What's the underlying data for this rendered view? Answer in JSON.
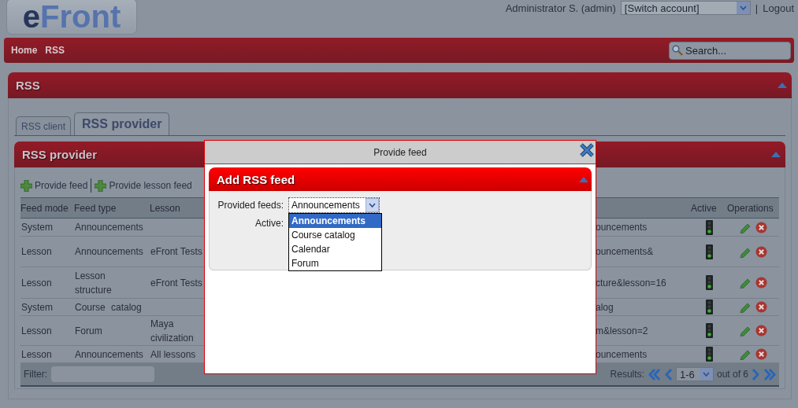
{
  "header": {
    "logo": [
      "e",
      "Front"
    ],
    "user": "Administrator S. (admin)",
    "account_select": "[Switch account]",
    "separator": "|",
    "logout": "Logout"
  },
  "nav": {
    "breadcrumbs": [
      "Home",
      "RSS"
    ],
    "search": {
      "placeholder": "Search..."
    }
  },
  "panel": {
    "title": "RSS",
    "tabs": [
      {
        "label": "RSS client",
        "selected": false
      },
      {
        "label": "RSS provider",
        "selected": true
      }
    ]
  },
  "provider": {
    "title": "RSS provider",
    "actions": [
      "Provide feed",
      "Provide lesson feed"
    ],
    "columns": {
      "feed_mode": "Feed mode",
      "feed_type": "Feed type",
      "lesson": "Lesson",
      "active": "Active",
      "operations": "Operations"
    },
    "rows": [
      {
        "feed_mode": "System",
        "feed_type": "Announcements",
        "lesson": "",
        "column_4": "ouncements",
        "active": true
      },
      {
        "feed_mode": "Lesson",
        "feed_type": "Announcements",
        "lesson": "eFront Tests",
        "column_4": "ouncements&",
        "active": true
      },
      {
        "feed_mode": "Lesson",
        "feed_type": "Lesson structure",
        "lesson": "eFront Tests",
        "column_4": "cture&lesson=16",
        "active": true
      },
      {
        "feed_mode": "System",
        "feed_type": "Course catalog",
        "lesson": "",
        "column_4": "alog",
        "active": true
      },
      {
        "feed_mode": "Lesson",
        "feed_type": "Forum",
        "lesson": "Maya civilization",
        "column_4": "m&lesson=2",
        "active": true
      },
      {
        "feed_mode": "Lesson",
        "feed_type": "Announcements",
        "lesson": "All lessons",
        "column_4": "ouncements",
        "active": true
      }
    ],
    "footer": {
      "filter_label": "Filter:",
      "results_label": "Results:",
      "page": "1-6",
      "total": "out of 6"
    }
  },
  "dialog": {
    "title": "Provide feed",
    "section": "Add RSS feed",
    "feeds_label": "Provided feeds:",
    "feeds_value": "Announcements",
    "active_label": "Active:",
    "options": [
      {
        "label": "Announcements",
        "selected": true
      },
      {
        "label": "Course catalog",
        "selected": false
      },
      {
        "label": "Calendar",
        "selected": false
      },
      {
        "label": "Forum",
        "selected": false
      }
    ]
  }
}
